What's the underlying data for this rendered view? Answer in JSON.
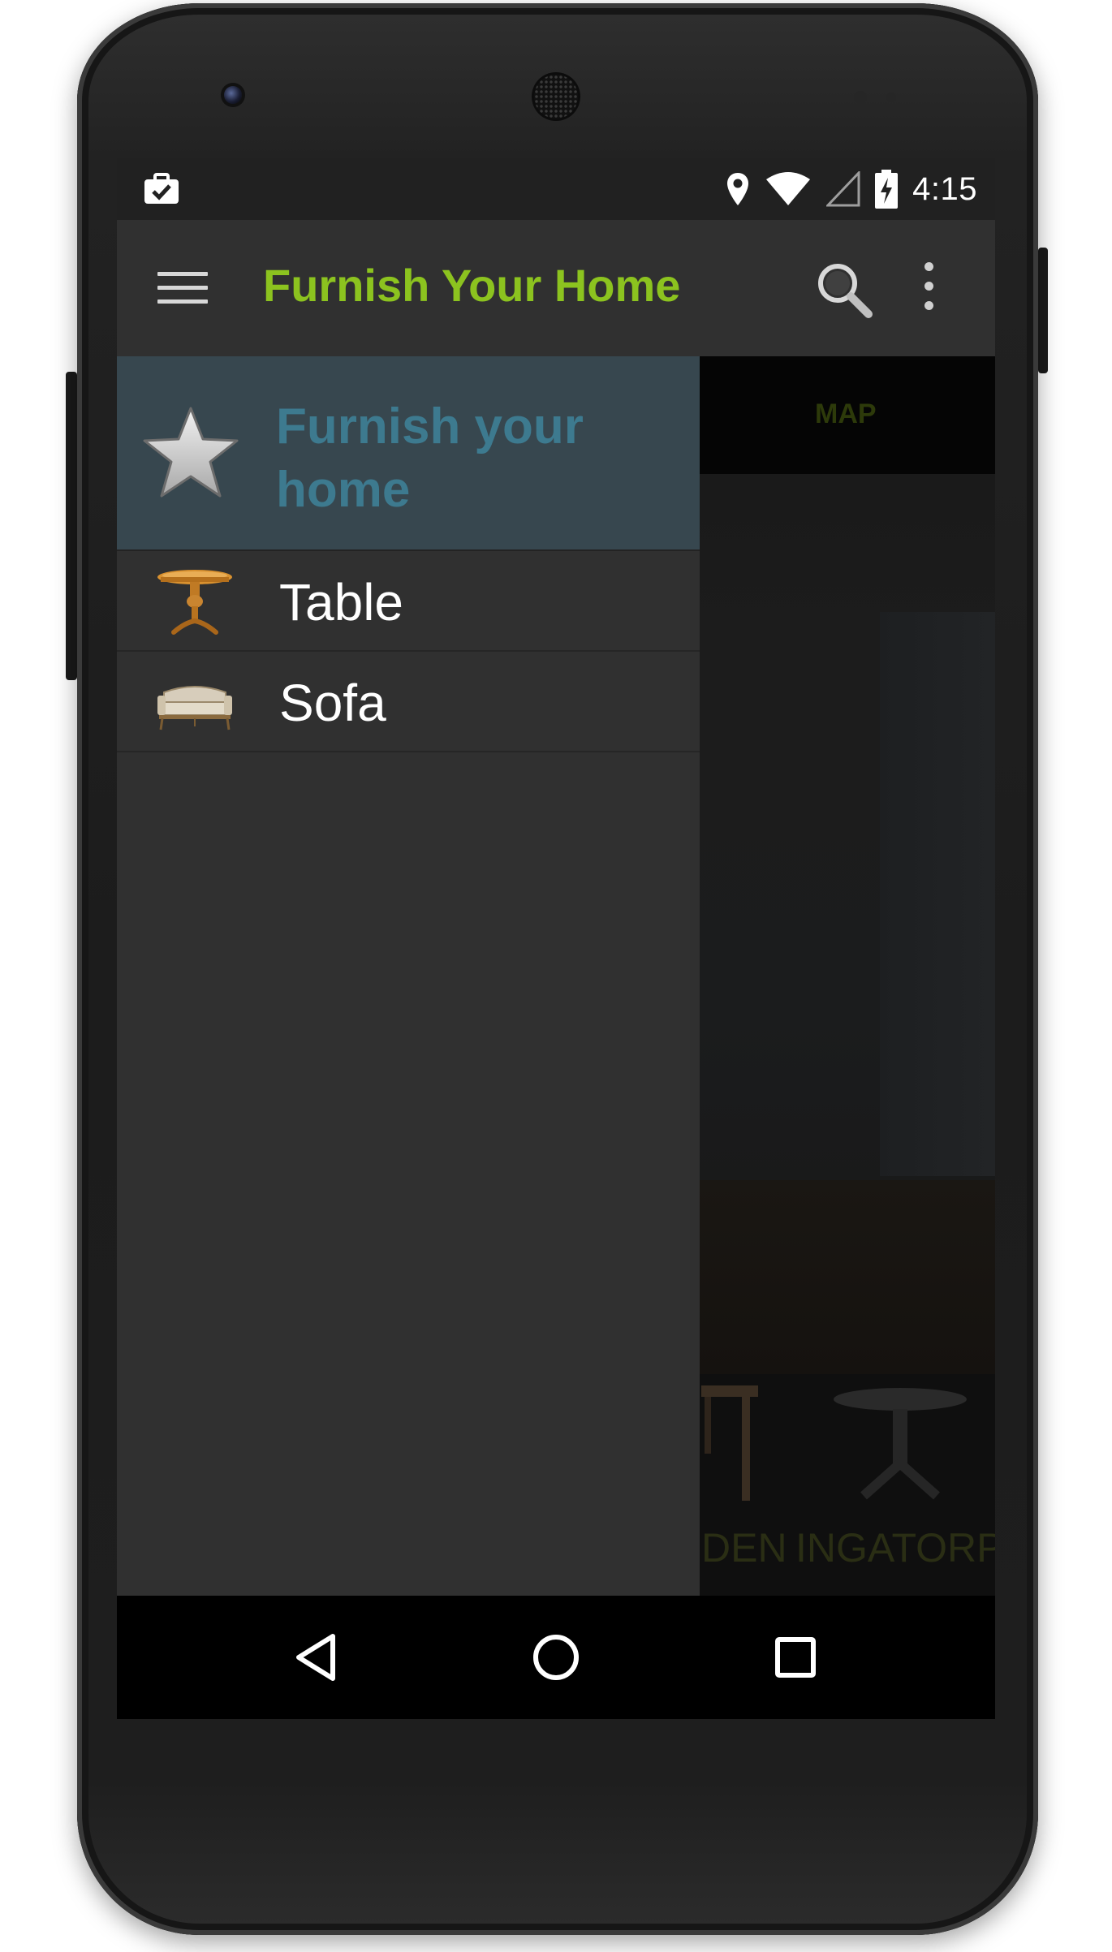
{
  "status_bar": {
    "time": "4:15",
    "icons": [
      "briefcase-check-icon",
      "location-pin-icon",
      "wifi-icon",
      "cell-signal-icon",
      "battery-charging-icon"
    ]
  },
  "toolbar": {
    "title": "Furnish Your Home",
    "title_color": "#8cc31f",
    "icons": [
      "hamburger-menu-icon",
      "search-icon",
      "overflow-menu-icon"
    ]
  },
  "tabs": {
    "map_label": "MAP"
  },
  "background_products": {
    "label_a": "DEN",
    "label_b": "INGATORP"
  },
  "drawer": {
    "header": {
      "title": "Furnish your home",
      "title_color": "#3d7a8f",
      "icon": "star-icon"
    },
    "items": [
      {
        "label": "Table",
        "icon": "table-icon"
      },
      {
        "label": "Sofa",
        "icon": "sofa-icon"
      }
    ]
  },
  "nav_bar": {
    "icons": [
      "back-icon",
      "home-icon",
      "recent-apps-icon"
    ]
  }
}
